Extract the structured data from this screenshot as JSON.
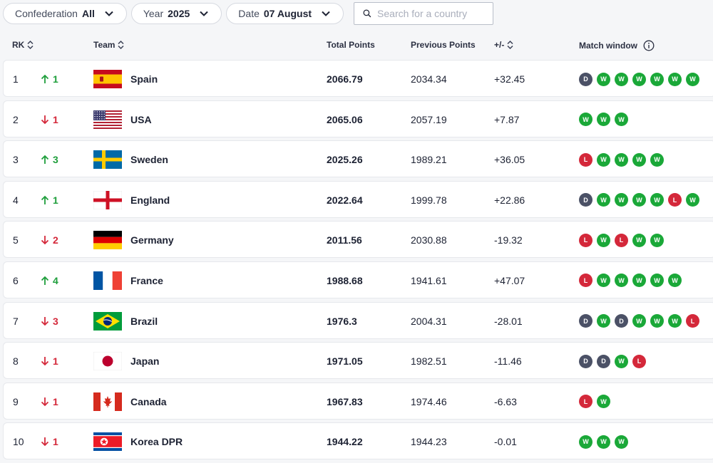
{
  "filters": {
    "confederation": {
      "label": "Confederation",
      "value": "All"
    },
    "year": {
      "label": "Year",
      "value": "2025"
    },
    "date": {
      "label": "Date",
      "value": "07 August"
    },
    "search": {
      "placeholder": "Search for a country"
    }
  },
  "columns": {
    "rank": "RK",
    "team": "Team",
    "total": "Total Points",
    "previous": "Previous Points",
    "diff": "+/-",
    "match_window": "Match window"
  },
  "colors": {
    "up": "#1e9e3b",
    "down": "#d4283a",
    "win": "#1aa838",
    "loss": "#d4283a",
    "draw": "#4b5166"
  },
  "rows": [
    {
      "rank": "1",
      "dir": "up",
      "move": "1",
      "flag": "spain",
      "team": "Spain",
      "total": "2066.79",
      "prev": "2034.34",
      "diff": "+32.45",
      "results": [
        "D",
        "W",
        "W",
        "W",
        "W",
        "W",
        "W"
      ]
    },
    {
      "rank": "2",
      "dir": "down",
      "move": "1",
      "flag": "usa",
      "team": "USA",
      "total": "2065.06",
      "prev": "2057.19",
      "diff": "+7.87",
      "results": [
        "W",
        "W",
        "W"
      ]
    },
    {
      "rank": "3",
      "dir": "up",
      "move": "3",
      "flag": "sweden",
      "team": "Sweden",
      "total": "2025.26",
      "prev": "1989.21",
      "diff": "+36.05",
      "results": [
        "L",
        "W",
        "W",
        "W",
        "W"
      ]
    },
    {
      "rank": "4",
      "dir": "up",
      "move": "1",
      "flag": "england",
      "team": "England",
      "total": "2022.64",
      "prev": "1999.78",
      "diff": "+22.86",
      "results": [
        "D",
        "W",
        "W",
        "W",
        "W",
        "L",
        "W"
      ]
    },
    {
      "rank": "5",
      "dir": "down",
      "move": "2",
      "flag": "germany",
      "team": "Germany",
      "total": "2011.56",
      "prev": "2030.88",
      "diff": "-19.32",
      "results": [
        "L",
        "W",
        "L",
        "W",
        "W"
      ]
    },
    {
      "rank": "6",
      "dir": "up",
      "move": "4",
      "flag": "france",
      "team": "France",
      "total": "1988.68",
      "prev": "1941.61",
      "diff": "+47.07",
      "results": [
        "L",
        "W",
        "W",
        "W",
        "W",
        "W"
      ]
    },
    {
      "rank": "7",
      "dir": "down",
      "move": "3",
      "flag": "brazil",
      "team": "Brazil",
      "total": "1976.3",
      "prev": "2004.31",
      "diff": "-28.01",
      "results": [
        "D",
        "W",
        "D",
        "W",
        "W",
        "W",
        "L"
      ]
    },
    {
      "rank": "8",
      "dir": "down",
      "move": "1",
      "flag": "japan",
      "team": "Japan",
      "total": "1971.05",
      "prev": "1982.51",
      "diff": "-11.46",
      "results": [
        "D",
        "D",
        "W",
        "L"
      ]
    },
    {
      "rank": "9",
      "dir": "down",
      "move": "1",
      "flag": "canada",
      "team": "Canada",
      "total": "1967.83",
      "prev": "1974.46",
      "diff": "-6.63",
      "results": [
        "L",
        "W"
      ]
    },
    {
      "rank": "10",
      "dir": "down",
      "move": "1",
      "flag": "korea-dpr",
      "team": "Korea DPR",
      "total": "1944.22",
      "prev": "1944.23",
      "diff": "-0.01",
      "results": [
        "W",
        "W",
        "W"
      ]
    }
  ]
}
